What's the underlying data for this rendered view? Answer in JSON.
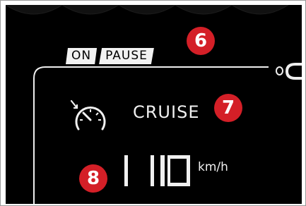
{
  "status_tags": {
    "on_label": "ON",
    "pause_label": "PAUSE"
  },
  "callouts": {
    "marker_6": "6",
    "marker_7": "7",
    "marker_8": "8"
  },
  "cruise": {
    "label": "CRUISE",
    "icon": "cruise-control-icon"
  },
  "speed": {
    "value": "110",
    "unit": "km/h"
  },
  "colors": {
    "background": "#000000",
    "text": "#f0f0f0",
    "marker": "#d41f27",
    "tag_bg": "#f2f2f2"
  }
}
